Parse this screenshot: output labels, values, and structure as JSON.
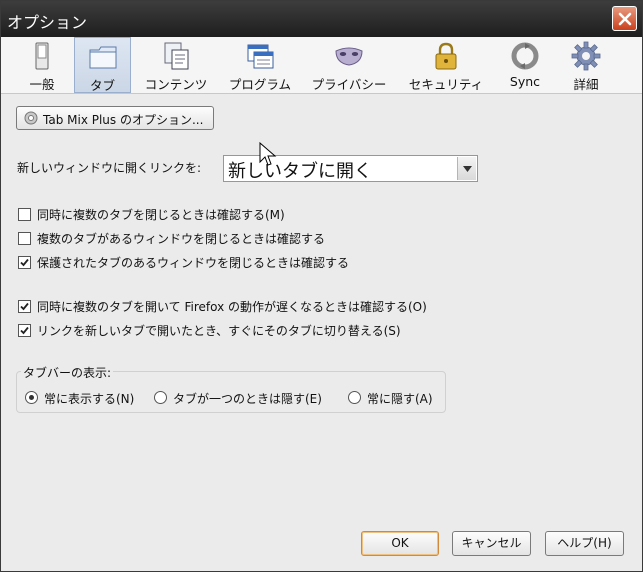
{
  "window": {
    "title": "オプション"
  },
  "toolbar": {
    "panes": [
      {
        "label": "一般",
        "icon": "switch-icon",
        "selected": false
      },
      {
        "label": "タブ",
        "icon": "tab-folder-icon",
        "selected": true
      },
      {
        "label": "コンテンツ",
        "icon": "content-document-icon",
        "selected": false
      },
      {
        "label": "プログラム",
        "icon": "applications-icon",
        "selected": false
      },
      {
        "label": "プライバシー",
        "icon": "privacy-mask-icon",
        "selected": false
      },
      {
        "label": "セキュリティ",
        "icon": "padlock-icon",
        "selected": false
      },
      {
        "label": "Sync",
        "icon": "sync-icon",
        "selected": false
      },
      {
        "label": "詳細",
        "icon": "gear-icon",
        "selected": false
      }
    ]
  },
  "content": {
    "tabmix_button_label": "Tab Mix Plus のオプション...",
    "open_links_label": "新しいウィンドウに開くリンクを:",
    "open_links_value": "新しいタブに開く",
    "checkboxes": [
      {
        "label": "同時に複数のタブを閉じるときは確認する(M)",
        "checked": false
      },
      {
        "label": "複数のタブがあるウィンドウを閉じるときは確認する",
        "checked": false
      },
      {
        "label": "保護されたタブのあるウィンドウを閉じるときは確認する",
        "checked": true
      },
      {
        "label": "同時に複数のタブを開いて Firefox の動作が遅くなるときは確認する(O)",
        "checked": true
      },
      {
        "label": "リンクを新しいタブで開いたとき、すぐにそのタブに切り替える(S)",
        "checked": true
      }
    ],
    "tabbar_caption": "タブバーの表示:",
    "tabbar_options": [
      {
        "label": "常に表示する(N)",
        "selected": true
      },
      {
        "label": "タブが一つのときは隠す(E)",
        "selected": false
      },
      {
        "label": "常に隠す(A)",
        "selected": false
      }
    ]
  },
  "footer": {
    "ok_label": "OK",
    "cancel_label": "キャンセル",
    "help_label": "ヘルプ(H)"
  }
}
